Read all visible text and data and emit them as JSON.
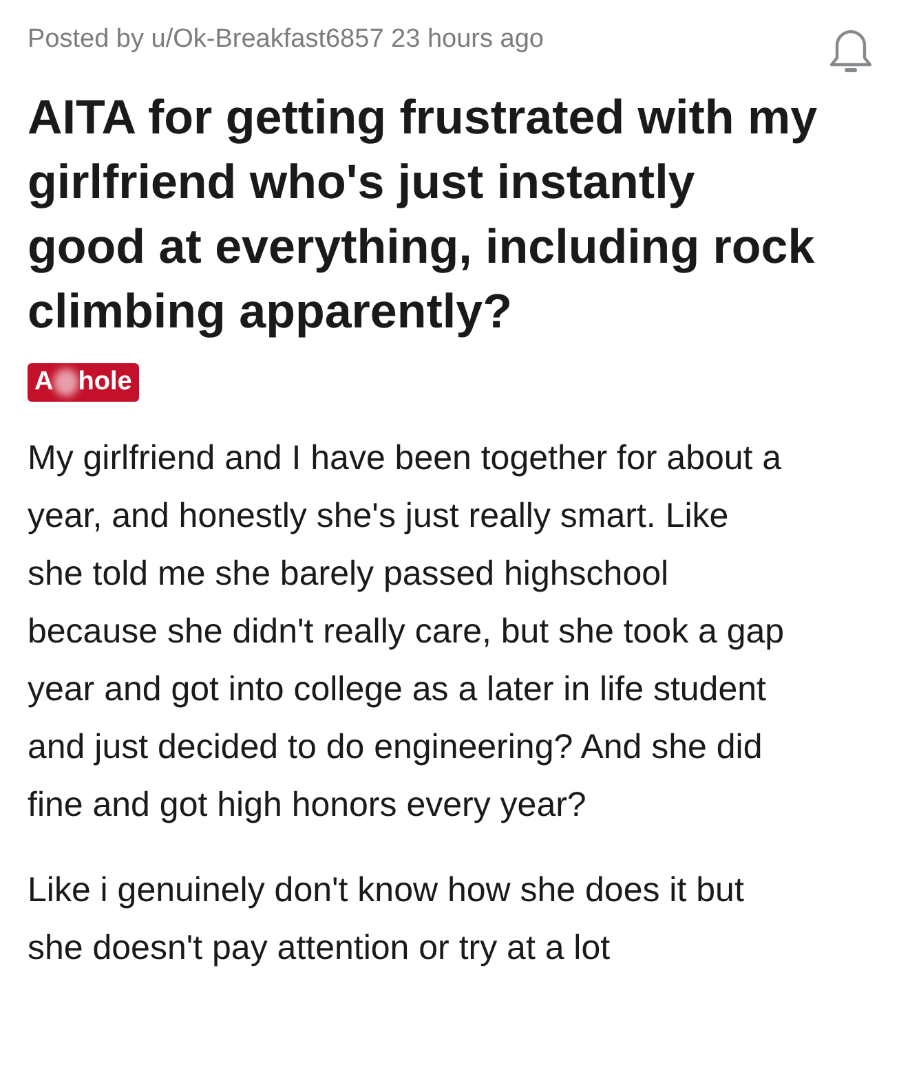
{
  "post": {
    "meta": "Posted by u/Ok-Breakfast6857 23 hours ago",
    "title": "AITA for getting frustrated with my girlfriend who's just instantly good at everything, including rock climbing apparently?",
    "flair": {
      "text_start": "A",
      "text_end": "hole",
      "censored": true,
      "color": "#c4102a"
    },
    "paragraphs": [
      "My girlfriend and I have been together for about a year, and honestly she's just really smart. Like she told me she barely passed highschool because she didn't really care, but she took a gap year and got into college as a later in life student and just decided to do engineering? And she did fine and got high honors every year?",
      "Like i genuinely don't know how she does it but she doesn't pay attention or try at a lot"
    ]
  }
}
